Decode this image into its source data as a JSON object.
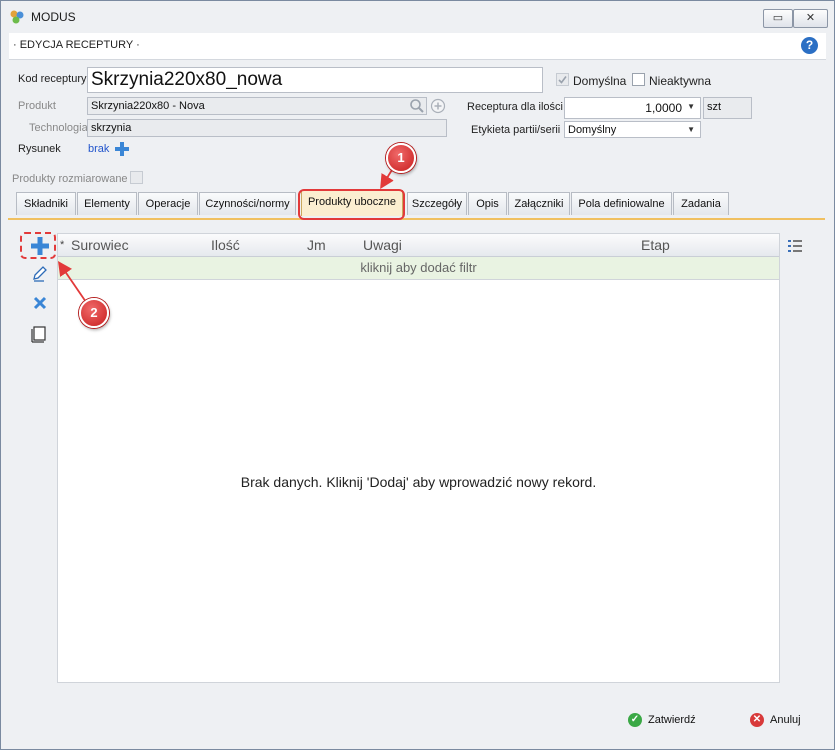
{
  "window": {
    "title": "MODUS"
  },
  "header": {
    "title": "· EDYCJA RECEPTURY ·"
  },
  "form": {
    "kod_label": "Kod receptury",
    "kod_value": "Skrzynia220x80_nowa",
    "domyslna_label": "Domyślna",
    "nieaktywna_label": "Nieaktywna",
    "produkt_label": "Produkt",
    "produkt_value": "Skrzynia220x80 - Nova",
    "technologia_label": "Technologia",
    "technologia_value": "skrzynia",
    "rysunek_label": "Rysunek",
    "rysunek_link": "brak",
    "receptura_label": "Receptura dla ilości",
    "receptura_value": "1,0000",
    "unit": "szt",
    "etykieta_label": "Etykieta partii/serii",
    "etykieta_value": "Domyślny",
    "produkty_rozm_label": "Produkty rozmiarowane"
  },
  "tabs": [
    {
      "label": "Składniki"
    },
    {
      "label": "Elementy"
    },
    {
      "label": "Operacje"
    },
    {
      "label": "Czynności/normy"
    },
    {
      "label": "Produkty uboczne"
    },
    {
      "label": "Szczegóły"
    },
    {
      "label": "Opis"
    },
    {
      "label": "Załączniki"
    },
    {
      "label": "Pola definiowalne"
    },
    {
      "label": "Zadania"
    }
  ],
  "grid": {
    "columns": [
      "Surowiec",
      "Ilość",
      "Jm",
      "Uwagi",
      "Etap"
    ],
    "star": "*",
    "filter_text": "kliknij aby dodać filtr",
    "empty_text": "Brak danych. Kliknij 'Dodaj' aby wprowadzić nowy rekord."
  },
  "callouts": [
    "1",
    "2"
  ],
  "footer": {
    "confirm_label": "Zatwierdź",
    "cancel_label": "Anuluj"
  },
  "colors": {
    "accent": "#2b6fc4",
    "callout": "#d62a2a",
    "active_tab": "#fbeed0",
    "filter_row": "#e9f3e2"
  }
}
